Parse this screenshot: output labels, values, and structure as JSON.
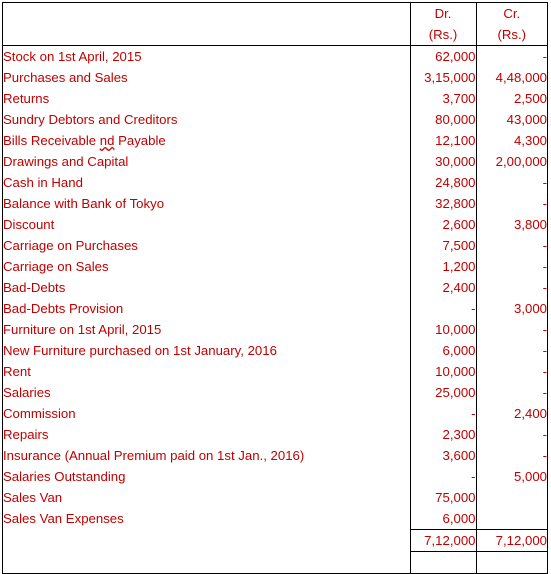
{
  "document": {
    "type": "trial-balance-table",
    "text_color": "#C00000",
    "border_color": "#000000",
    "background": "#FFFFFF"
  },
  "table": {
    "columns": [
      {
        "key": "particulars",
        "label": "",
        "align": "left"
      },
      {
        "key": "dr",
        "label": "Dr.",
        "sublabel": "(Rs.)",
        "align": "right"
      },
      {
        "key": "cr",
        "label": "Cr.",
        "sublabel": "(Rs.)",
        "align": "right"
      }
    ],
    "rows": [
      {
        "particulars": "Stock on 1st April, 2015",
        "dr": "62,000",
        "cr": "-"
      },
      {
        "particulars": "Purchases and Sales",
        "dr": "3,15,000",
        "cr": "4,48,000"
      },
      {
        "particulars": "Returns",
        "dr": "3,700",
        "cr": "2,500"
      },
      {
        "particulars": "Sundry Debtors and Creditors",
        "dr": "80,000",
        "cr": "43,000"
      },
      {
        "particulars": "Bills Receivable nd Payable",
        "dr": "12,100",
        "cr": "4,300",
        "misspelled_token": "nd"
      },
      {
        "particulars": "Drawings and Capital",
        "dr": "30,000",
        "cr": "2,00,000"
      },
      {
        "particulars": "Cash in Hand",
        "dr": "24,800",
        "cr": "-"
      },
      {
        "particulars": "Balance with Bank of Tokyo",
        "dr": "32,800",
        "cr": "-"
      },
      {
        "particulars": "Discount",
        "dr": "2,600",
        "cr": "3,800"
      },
      {
        "particulars": "Carriage on Purchases",
        "dr": "7,500",
        "cr": "-"
      },
      {
        "particulars": "Carriage on Sales",
        "dr": "1,200",
        "cr": "-"
      },
      {
        "particulars": "Bad-Debts",
        "dr": "2,400",
        "cr": "-"
      },
      {
        "particulars": "Bad-Debts Provision",
        "dr": "-",
        "cr": "3,000"
      },
      {
        "particulars": "Furniture on 1st April, 2015",
        "dr": "10,000",
        "cr": "-"
      },
      {
        "particulars": "New Furniture purchased on 1st January, 2016",
        "dr": "6,000",
        "cr": "-"
      },
      {
        "particulars": "Rent",
        "dr": "10,000",
        "cr": "-"
      },
      {
        "particulars": "Salaries",
        "dr": "25,000",
        "cr": "-"
      },
      {
        "particulars": "Commission",
        "dr": "-",
        "cr": "2,400"
      },
      {
        "particulars": "Repairs",
        "dr": "2,300",
        "cr": "-"
      },
      {
        "particulars": "Insurance (Annual Premium paid on 1st Jan., 2016)",
        "dr": "3,600",
        "cr": "-"
      },
      {
        "particulars": "Salaries Outstanding",
        "dr": "-",
        "cr": "5,000"
      },
      {
        "particulars": "Sales Van",
        "dr": "75,000",
        "cr": ""
      },
      {
        "particulars": "Sales Van Expenses",
        "dr": "6,000",
        "cr": ""
      }
    ],
    "totals": {
      "particulars": "",
      "dr": "7,12,000",
      "cr": "7,12,000"
    },
    "trailing_row": {
      "particulars": "",
      "dr": "",
      "cr": ""
    }
  }
}
